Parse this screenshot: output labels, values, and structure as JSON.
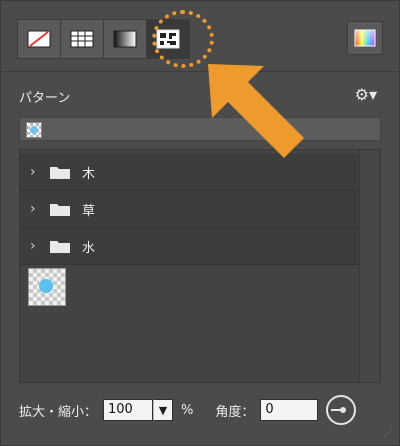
{
  "toolbar": {
    "tools": [
      {
        "icon": "no-fill-icon",
        "active": false
      },
      {
        "icon": "solid-grid-icon",
        "active": false
      },
      {
        "icon": "gradient-icon",
        "active": false
      },
      {
        "icon": "pattern-icon",
        "active": true
      }
    ],
    "color_picker_icon": "color-picker-icon"
  },
  "panel": {
    "title": "パターン",
    "gear_label": "⚙▾"
  },
  "folders": [
    {
      "name": "木"
    },
    {
      "name": "草"
    },
    {
      "name": "水"
    }
  ],
  "bottom": {
    "scale_label": "拡大・縮小：",
    "scale_value": "100",
    "percent": "%",
    "angle_label": "角度：",
    "angle_value": "0"
  },
  "colors": {
    "panel_bg": "#4b4b4b",
    "accent_annotation": "#ee9a2c",
    "pattern_dot": "#5bc0ee"
  }
}
